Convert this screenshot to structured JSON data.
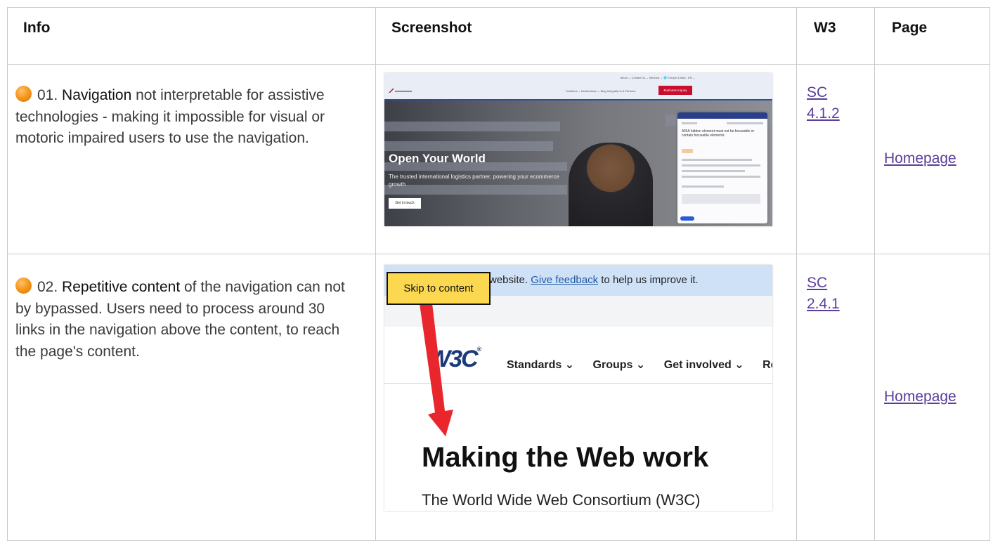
{
  "table": {
    "headers": [
      "Info",
      "Screenshot",
      "W3",
      "Page"
    ],
    "rows": [
      {
        "number": "01.",
        "title": "Navigation",
        "description": "not interpretable for assistive technologies - making it impossible for visual or motoric impaired users to use the navigation.",
        "w3_line1": "SC",
        "w3_line2": "4.1.2",
        "page": "Homepage",
        "severity_color": "#f59a1c"
      },
      {
        "number": "02.",
        "title": "Repetitive content",
        "description": "of the navigation can not by bypassed. Users need to process around 30 links in the navigation above the content, to reach the page's content.",
        "w3_line1": "SC",
        "w3_line2": "2.4.1",
        "page": "Homepage",
        "severity_color": "#f59a1c"
      }
    ]
  },
  "shot1": {
    "nav_top": "About ⌄    Contact Us ⌄    Mercury ⌄    🌐 Europe & Asia - EN ⌄",
    "nav_main": "Solutions ⌄    Destinations ⌄    Blog    Integrations & Partners",
    "business_button": "Business Inquiry",
    "hero_title": "Open Your World",
    "hero_text": "The trusted international logistics partner, powering your ecommerce growth",
    "cta": "Get in touch",
    "panel_heading": "ARIA hidden element must not be focusable or contain focusable elements"
  },
  "shot2": {
    "skip_label": "Skip to content",
    "banner_text": "website.",
    "banner_link": "Give feedback",
    "banner_rest": "to help us improve it.",
    "logo": "W3C",
    "nav": [
      "Standards ⌄",
      "Groups ⌄",
      "Get involved ⌄",
      "Re"
    ],
    "heading": "Making the Web work",
    "subheading": "The World Wide Web Consortium (W3C)"
  }
}
